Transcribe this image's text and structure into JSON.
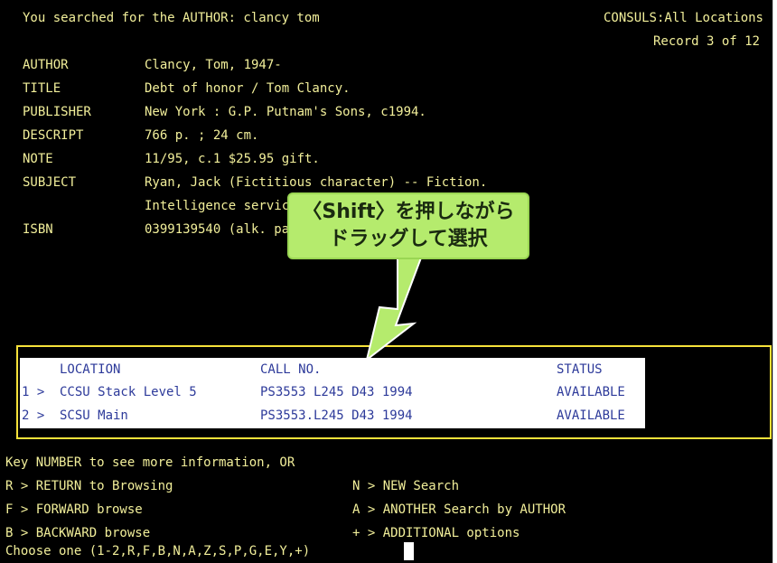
{
  "header": {
    "search_line": "You searched for the AUTHOR: clancy tom",
    "scope": "CONSULS:All Locations",
    "record": "Record 3 of 12"
  },
  "record_fields": [
    {
      "label": "AUTHOR",
      "value": "Clancy, Tom, 1947-"
    },
    {
      "label": "TITLE",
      "value": "Debt of honor / Tom Clancy."
    },
    {
      "label": "PUBLISHER",
      "value": "New York : G.P. Putnam's Sons, c1994."
    },
    {
      "label": "DESCRIPT",
      "value": "766 p. ; 24 cm."
    },
    {
      "label": "NOTE",
      "value": "11/95, c.1 $25.95 gift."
    },
    {
      "label": "SUBJECT",
      "value": "Ryan, Jack (Fictitious character) -- Fiction."
    },
    {
      "label": "",
      "value": "Intelligence service -- Fiction."
    },
    {
      "label": "ISBN",
      "value": "0399139540 (alk. paper)"
    }
  ],
  "holdings": {
    "headers": {
      "location": "LOCATION",
      "call_no": "CALL NO.",
      "status": "STATUS"
    },
    "rows": [
      {
        "num": "1 >",
        "location": "CCSU Stack Level 5",
        "call_no": "PS3553 L245 D43 1994",
        "status": "AVAILABLE"
      },
      {
        "num": "2 >",
        "location": "SCSU Main",
        "call_no": "PS3553.L245 D43 1994",
        "status": "AVAILABLE"
      }
    ]
  },
  "menu": {
    "prompt": "Key NUMBER to see more information, OR",
    "options": [
      {
        "left": "R > RETURN to Browsing",
        "right": "N > NEW Search"
      },
      {
        "left": "F > FORWARD browse",
        "right": "A > ANOTHER Search by AUTHOR"
      },
      {
        "left": "B > BACKWARD browse",
        "right": "+ > ADDITIONAL options"
      }
    ],
    "choose": "Choose one (1-2,R,F,B,N,A,Z,S,P,G,E,Y,+)"
  },
  "callout": {
    "line1": "〈Shift〉を押しながら",
    "line2": "ドラッグして選択"
  },
  "colors": {
    "terminal_bg": "#000000",
    "terminal_text": "#f2ef9a",
    "selection_border": "#f7e23a",
    "selected_text": "#2d3a9a",
    "callout_bg": "#b5eb6d"
  }
}
